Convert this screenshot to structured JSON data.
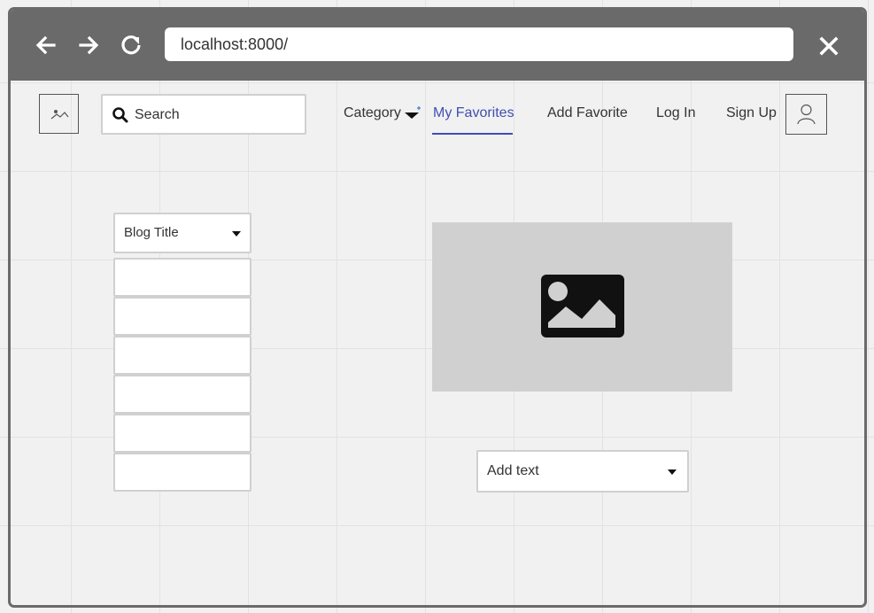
{
  "browser": {
    "url": "localhost:8000/",
    "back_icon": "arrow-left-icon",
    "forward_icon": "arrow-right-icon",
    "reload_icon": "reload-icon",
    "close_icon": "close-icon"
  },
  "header": {
    "logo_icon": "image-icon",
    "search": {
      "placeholder": "Search",
      "value": ""
    },
    "nav": [
      {
        "label": "Category",
        "has_dropdown": true,
        "active": false
      },
      {
        "label": "My Favorites",
        "active": true
      },
      {
        "label": "Add Favorite",
        "active": false
      },
      {
        "label": "Log In",
        "active": false
      },
      {
        "label": "Sign Up",
        "active": false
      }
    ],
    "avatar_icon": "user-icon"
  },
  "sidebar": {
    "select_label": "Blog Title",
    "items": [
      "",
      "",
      "",
      "",
      "",
      ""
    ]
  },
  "main": {
    "image_icon": "image-icon",
    "text_select_label": "Add text"
  },
  "colors": {
    "browser_chrome": "#6a6a6a",
    "page_bg": "#f1f1f1",
    "accent": "#3f4fb0",
    "placeholder_fill": "#d0d0d0",
    "border": "#d0d0d0"
  }
}
